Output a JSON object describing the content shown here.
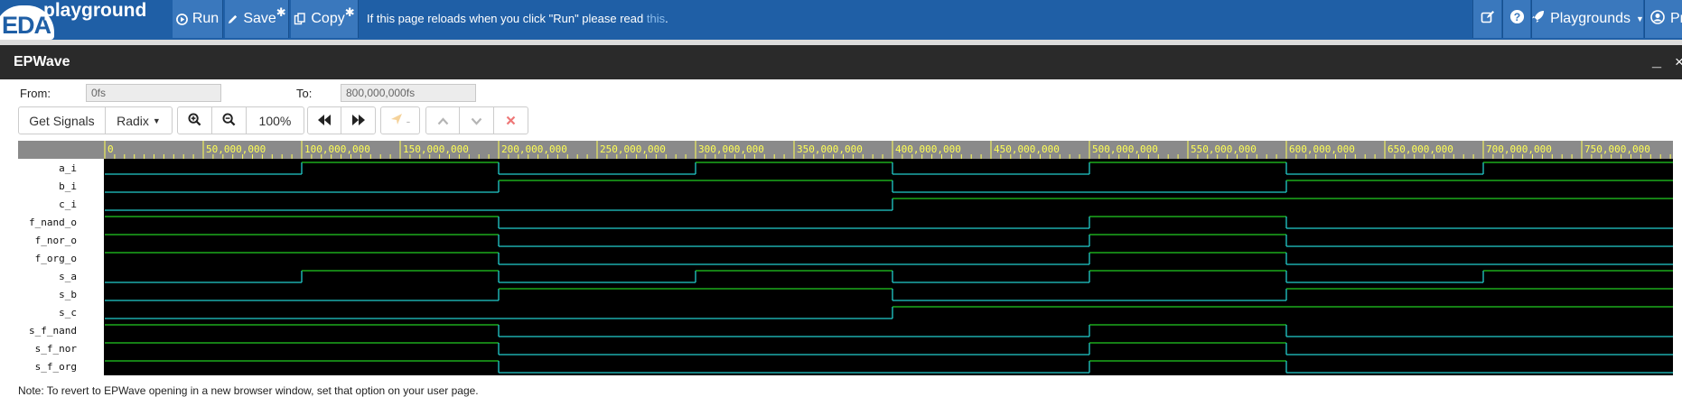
{
  "topbar": {
    "logo_left": "EDA",
    "logo_right": "playground",
    "run_label": "Run",
    "save_label": "Save",
    "save_mark": "✱",
    "copy_label": "Copy",
    "copy_mark": "✱",
    "notice_text": "If this page reloads when you click \"Run\" please read ",
    "notice_link": "this",
    "notice_end": ".",
    "playgrounds_label": "Playgrounds",
    "profile_label": "Pr"
  },
  "epwave": {
    "title": "EPWave",
    "minimize_symbol": "_",
    "close_symbol": "×",
    "from_label": "From:",
    "from_value": "0fs",
    "to_label": "To:",
    "to_value": "800,000,000fs"
  },
  "toolbar": {
    "get_signals_label": "Get Signals",
    "radix_label": "Radix",
    "zoom_level": "100%",
    "marker_label": "-"
  },
  "waveform": {
    "time_end": 800000000,
    "ticks": [
      "0",
      "50,000,000",
      "100,000,000",
      "150,000,000",
      "200,000,000",
      "250,000,000",
      "300,000,000",
      "350,000,000",
      "400,000,000",
      "450,000,000",
      "500,000,000",
      "550,000,000",
      "600,000,000",
      "650,000,000",
      "700,000,000",
      "750,000,000"
    ],
    "tick_values": [
      0,
      50000000,
      100000000,
      150000000,
      200000000,
      250000000,
      300000000,
      350000000,
      400000000,
      450000000,
      500000000,
      550000000,
      600000000,
      650000000,
      700000000,
      750000000
    ],
    "signals": [
      {
        "name": "a_i",
        "initial": 0,
        "transitions": [
          100000000,
          200000000,
          300000000,
          400000000,
          500000000,
          600000000,
          700000000
        ]
      },
      {
        "name": "b_i",
        "initial": 0,
        "transitions": [
          200000000,
          400000000,
          600000000
        ]
      },
      {
        "name": "c_i",
        "initial": 0,
        "transitions": [
          400000000
        ]
      },
      {
        "name": "f_nand_o",
        "initial": 1,
        "transitions": [
          200000000,
          500000000,
          600000000
        ]
      },
      {
        "name": "f_nor_o",
        "initial": 1,
        "transitions": [
          200000000,
          500000000,
          600000000
        ]
      },
      {
        "name": "f_org_o",
        "initial": 1,
        "transitions": [
          200000000,
          500000000,
          600000000
        ]
      },
      {
        "name": "s_a",
        "initial": 0,
        "transitions": [
          100000000,
          200000000,
          300000000,
          400000000,
          500000000,
          600000000,
          700000000
        ]
      },
      {
        "name": "s_b",
        "initial": 0,
        "transitions": [
          200000000,
          400000000,
          600000000
        ]
      },
      {
        "name": "s_c",
        "initial": 0,
        "transitions": [
          400000000
        ]
      },
      {
        "name": "s_f_nand",
        "initial": 1,
        "transitions": [
          200000000,
          500000000,
          600000000
        ]
      },
      {
        "name": "s_f_nor",
        "initial": 1,
        "transitions": [
          200000000,
          500000000,
          600000000
        ]
      },
      {
        "name": "s_f_org",
        "initial": 1,
        "transitions": [
          200000000,
          500000000,
          600000000
        ]
      }
    ],
    "colors": {
      "background": "#000000",
      "label_panel": "#ffffff",
      "ruler": "#8a8a8a",
      "ruler_text": "#ffff55",
      "high": "#22cc22",
      "low": "#22cccc"
    }
  },
  "footer": {
    "note": "Note: To revert to EPWave opening in a new browser window, set that option on your user page."
  }
}
